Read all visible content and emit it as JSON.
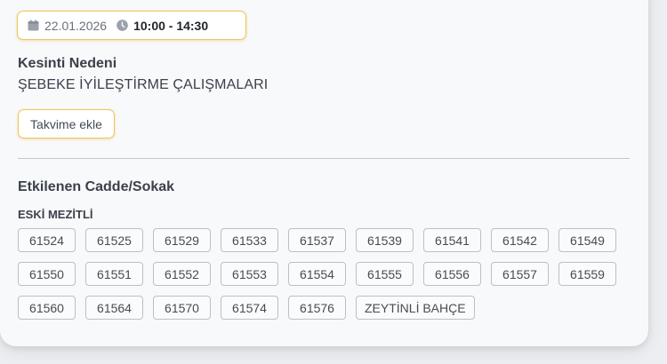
{
  "schedule": {
    "date": "22.01.2026",
    "time": "10:00 - 14:30",
    "calendar_icon": "calendar-icon",
    "clock_icon": "clock-icon"
  },
  "reason": {
    "title": "Kesinti Nedeni",
    "value": "ŞEBEKE İYİLEŞTİRME ÇALIŞMALARI"
  },
  "calendar_button": {
    "label": "Takvime ekle"
  },
  "streets": {
    "title": "Etkilenen Cadde/Sokak",
    "district": "ESKİ MEZİTLİ",
    "items": [
      "61524",
      "61525",
      "61529",
      "61533",
      "61537",
      "61539",
      "61541",
      "61542",
      "61549",
      "61550",
      "61551",
      "61552",
      "61553",
      "61554",
      "61555",
      "61556",
      "61557",
      "61559",
      "61560",
      "61564",
      "61570",
      "61574",
      "61576",
      "ZEYTİNLİ BAHÇE"
    ]
  },
  "colors": {
    "accent_border": "#f0c45a",
    "tag_border": "#b9c0c9",
    "card_background": "#f8f9fb",
    "page_background": "#eceef1"
  }
}
